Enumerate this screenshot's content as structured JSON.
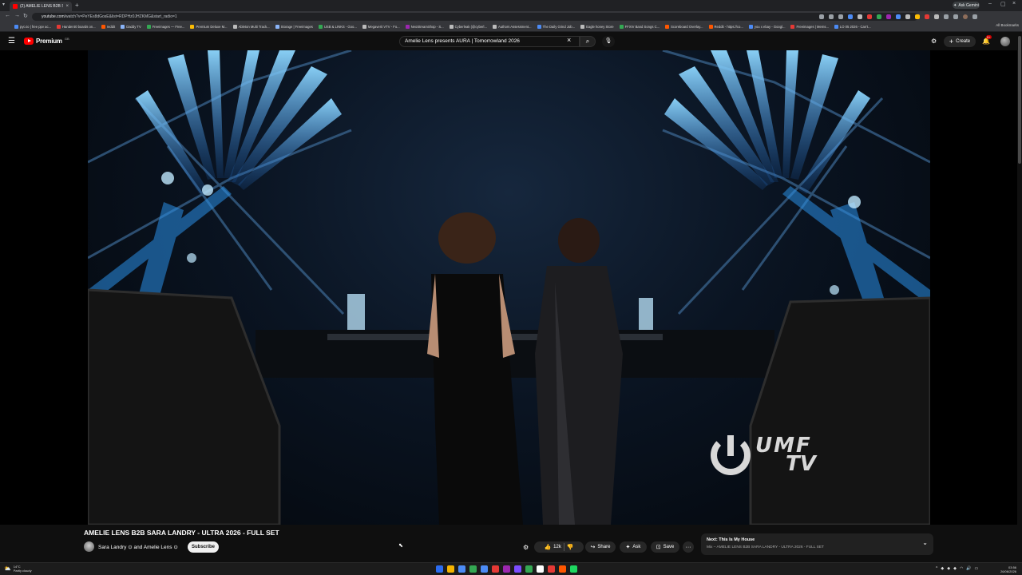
{
  "browser": {
    "tab_title": "(2) AMELIE LENS B2B SARA...",
    "url_domain": "youtube.com",
    "url_rest": "/watch?v=PeYEs8dGosE&list=RDPHz0JHZKMG&start_radio=1",
    "ask_gemini": "Ask Gemini",
    "all_bookmarks": "All Bookmarks",
    "bookmarks": [
      {
        "label": "pyo.to | free ppv ac...",
        "color": "#4c8bf5"
      },
      {
        "label": "Hander40 boards on...",
        "color": "#e53935"
      },
      {
        "label": "reddit",
        "color": "#ff5700"
      },
      {
        "label": "Daddy TV",
        "color": "#8ab4f8"
      },
      {
        "label": "Freeimages — Free...",
        "color": "#34a853"
      },
      {
        "label": "Premium Deluxe M...",
        "color": "#fbbc04"
      },
      {
        "label": "Ableton Multi Track...",
        "color": "#bbbbbb"
      },
      {
        "label": "Storage | Freeimages",
        "color": "#8ab4f8"
      },
      {
        "label": "USB & LINKS - Goo...",
        "color": "#34a853"
      },
      {
        "label": "Megaverit VTV - Fo...",
        "color": "#bbbbbb"
      },
      {
        "label": "NeoStreamShop - S...",
        "color": "#9c27b0"
      },
      {
        "label": "Cyberleak (@cyberl...",
        "color": "#bbbbbb"
      },
      {
        "label": "Authors Assessment...",
        "color": "#bbbbbb"
      },
      {
        "label": "The Daily Grind Job...",
        "color": "#4c8bf5"
      },
      {
        "label": "Eagle honey Store",
        "color": "#bbbbbb"
      },
      {
        "label": "FFXIV Band Songs C...",
        "color": "#34a853"
      },
      {
        "label": "Scoreboard Overlay...",
        "color": "#ff5700"
      },
      {
        "label": "Reddit - https://co...",
        "color": "#ff5700"
      },
      {
        "label": "you x ebay - Googl...",
        "color": "#4c8bf5"
      },
      {
        "label": "Freeimages | Mems...",
        "color": "#e53935"
      },
      {
        "label": "LO 05 2026 - Can't...",
        "color": "#4c8bf5"
      }
    ]
  },
  "youtube": {
    "logo_text": "Premium",
    "logo_suffix": "GB",
    "search_value": "Amelie Lens presents AURA | Tomorrowland 2026",
    "create_label": "Create",
    "notif_count": "9+"
  },
  "video": {
    "title": "AMELIE LENS B2B SARA LANDRY - ULTRA 2026 - FULL SET",
    "channel": "Sara Landry ⊙ and Amelie Lens ⊙",
    "subscribe_label": "Subscribe",
    "likes": "12k",
    "share_label": "Share",
    "ask_label": "Ask",
    "save_label": "Save",
    "watermark_line1": "UMF",
    "watermark_line2": "TV"
  },
  "next_card": {
    "line1": "Next: This Is My House",
    "line2": "Mix – AMELIE LENS B2B SARA LANDRY - ULTRA 2026 - FULL SET"
  },
  "taskbar": {
    "temp": "14°C",
    "condition": "Partly cloudy",
    "time": "03:56",
    "date": "26/06/2026",
    "icon_colors": [
      "#2b6cf0",
      "#f5b400",
      "#4c8bf5",
      "#34a853",
      "#4c8bf5",
      "#e53935",
      "#9c27b0",
      "#7c4dff",
      "#34a853",
      "#ffffff",
      "#e53935",
      "#ff5700",
      "#1ed760"
    ]
  }
}
